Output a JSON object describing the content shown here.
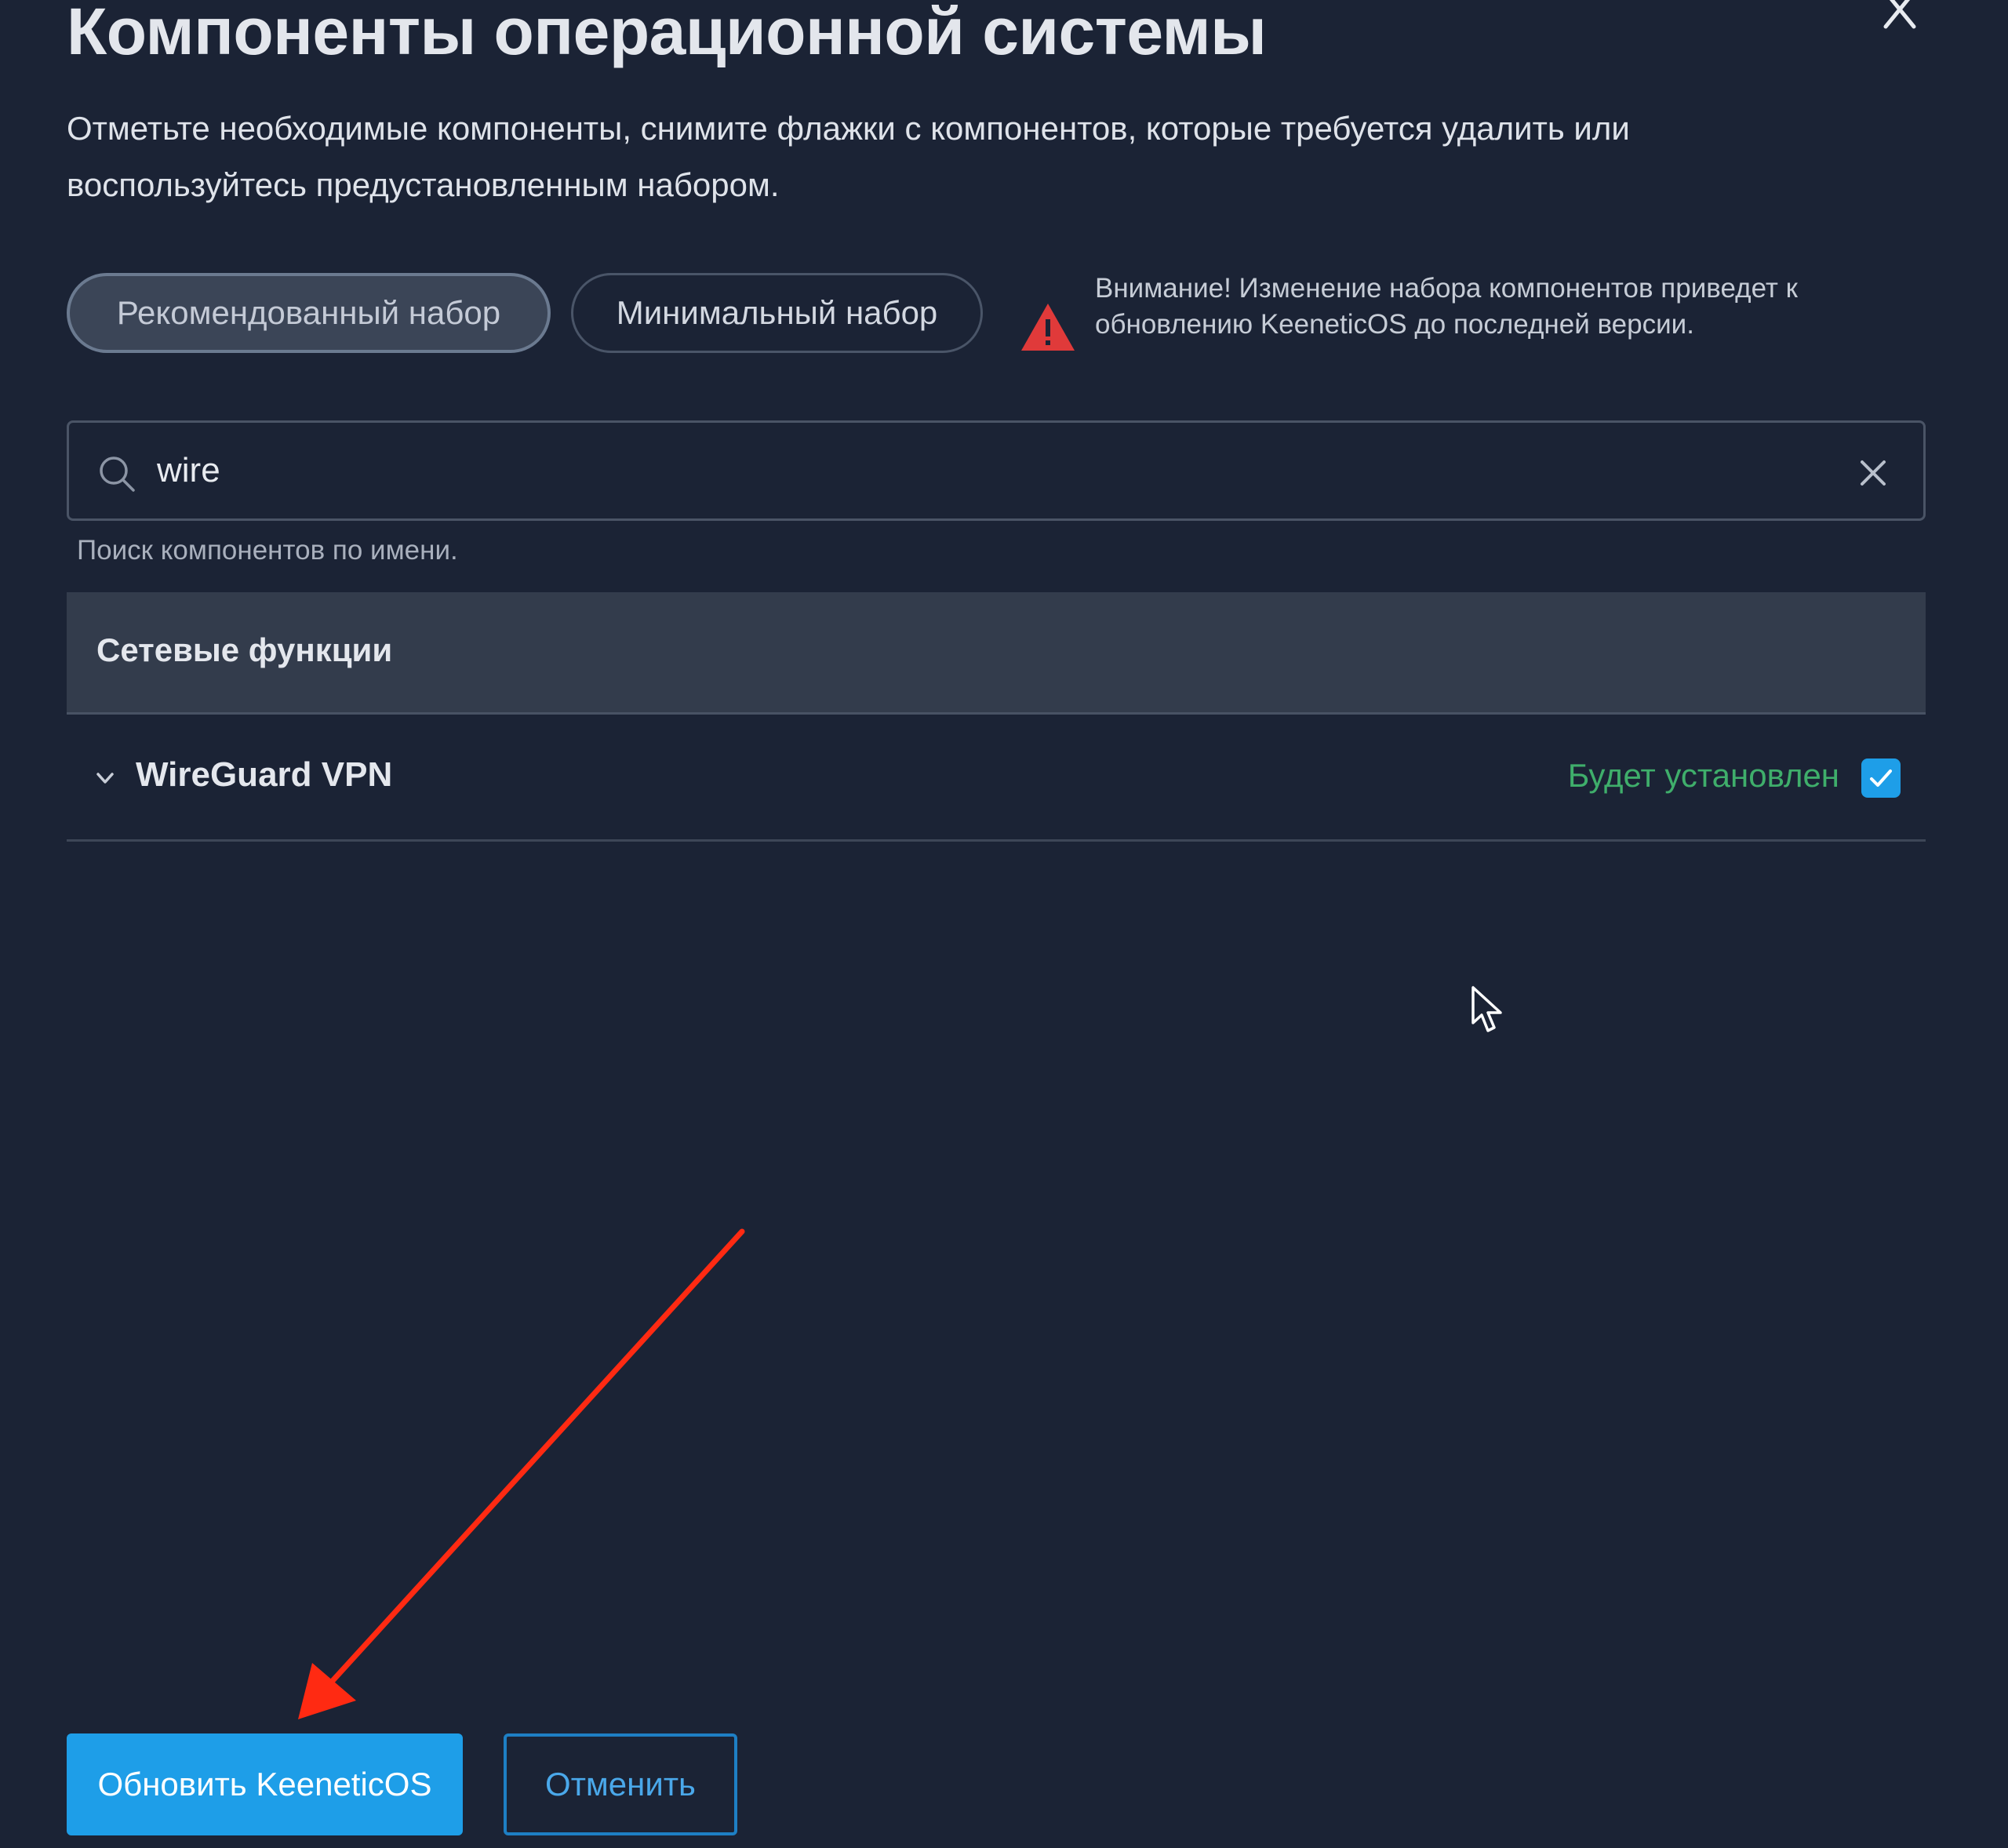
{
  "dialog": {
    "title": "Компоненты операционной системы",
    "description": "Отметьте необходимые компоненты, снимите флажки с компонентов, которые требуется удалить или воспользуйтесь предустановленным набором.",
    "close_icon": "close-icon"
  },
  "presets": {
    "recommended_label": "Рекомендованный набор",
    "minimal_label": "Минимальный набор",
    "selected": "recommended"
  },
  "warning": {
    "icon": "warning-triangle-icon",
    "text": "Внимание! Изменение набора компонентов приведет к обновлению KeeneticOS до последней версии."
  },
  "search": {
    "value": "wire",
    "icon": "search-icon",
    "clear_icon": "clear-icon",
    "hint": "Поиск компонентов по имени."
  },
  "section": {
    "title": "Сетевые функции",
    "items": [
      {
        "name": "WireGuard VPN",
        "status": "Будет установлен",
        "checked": true,
        "expand_icon": "chevron-down-icon"
      }
    ]
  },
  "footer": {
    "update_label": "Обновить KeeneticOS",
    "cancel_label": "Отменить"
  },
  "colors": {
    "background": "#1b2335",
    "accent": "#1e9ee8",
    "status_green": "#3fae6b",
    "warning_red": "#e03a3a",
    "annotation_arrow": "#ff2a12"
  }
}
